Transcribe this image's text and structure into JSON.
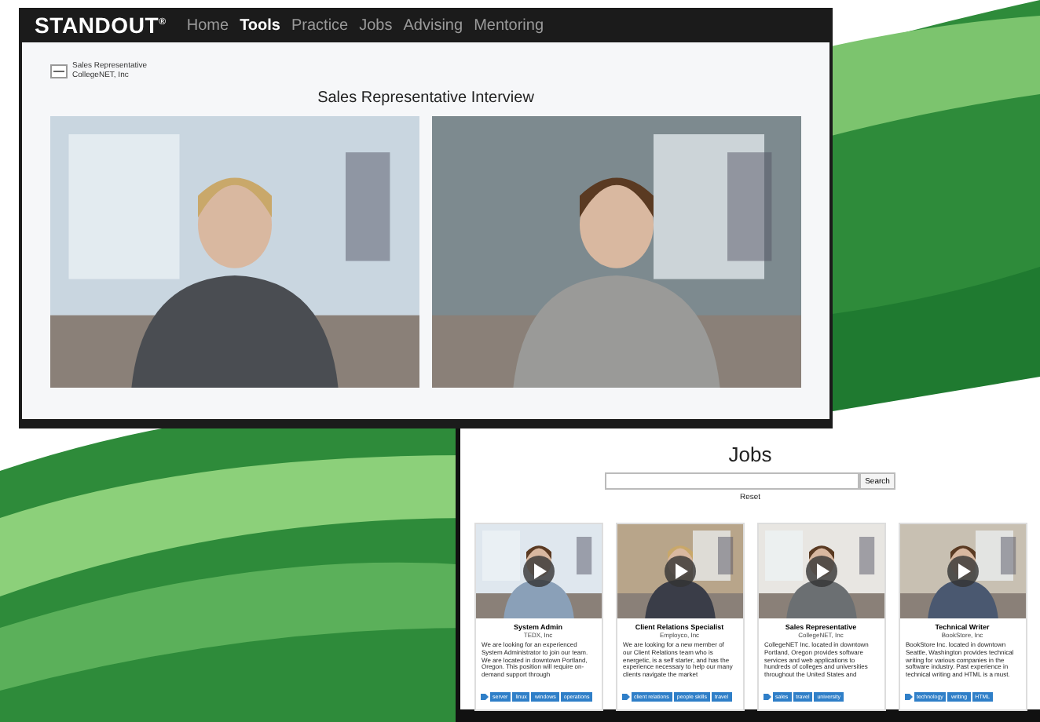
{
  "interview_window": {
    "logo": "STANDOUT",
    "logo_mark": "®",
    "nav": [
      {
        "label": "Home",
        "selected": false
      },
      {
        "label": "Tools",
        "selected": true
      },
      {
        "label": "Practice",
        "selected": false
      },
      {
        "label": "Jobs",
        "selected": false
      },
      {
        "label": "Advising",
        "selected": false
      },
      {
        "label": "Mentoring",
        "selected": false
      }
    ],
    "job_title": "Sales Representative",
    "company": "CollegeNET, Inc",
    "heading": "Sales Representative Interview"
  },
  "jobs_window": {
    "heading": "Jobs",
    "search_button": "Search",
    "reset": "Reset",
    "cards": [
      {
        "title": "System Admin",
        "company": "TEDX, Inc",
        "description": "We are looking for an experienced System Administrator to join our team. We are located in downtown Portland, Oregon. This position will require on-demand support through",
        "tags": [
          "server",
          "linux",
          "windows",
          "operations"
        ]
      },
      {
        "title": "Client Relations Specialist",
        "company": "Employco, Inc",
        "description": "We are looking for a new member of our Client Relations team who is energetic, is a self starter, and has the experience necessary to help our many clients navigate the market",
        "tags": [
          "client relations",
          "people skills",
          "travel"
        ]
      },
      {
        "title": "Sales Representative",
        "company": "CollegeNET, Inc",
        "description": "CollegeNET Inc. located in downtown Portland, Oregon provides software services and web applications to hundreds of colleges and universities throughout the United States and",
        "tags": [
          "sales",
          "travel",
          "university"
        ]
      },
      {
        "title": "Technical Writer",
        "company": "BookStore, Inc",
        "description": "BookStore Inc. located in downtown Seattle, Washington provides technical writing for various companies in the software industry. Past experience in technical writing and HTML is a must.",
        "tags": [
          "technology",
          "writing",
          "HTML"
        ]
      }
    ]
  }
}
